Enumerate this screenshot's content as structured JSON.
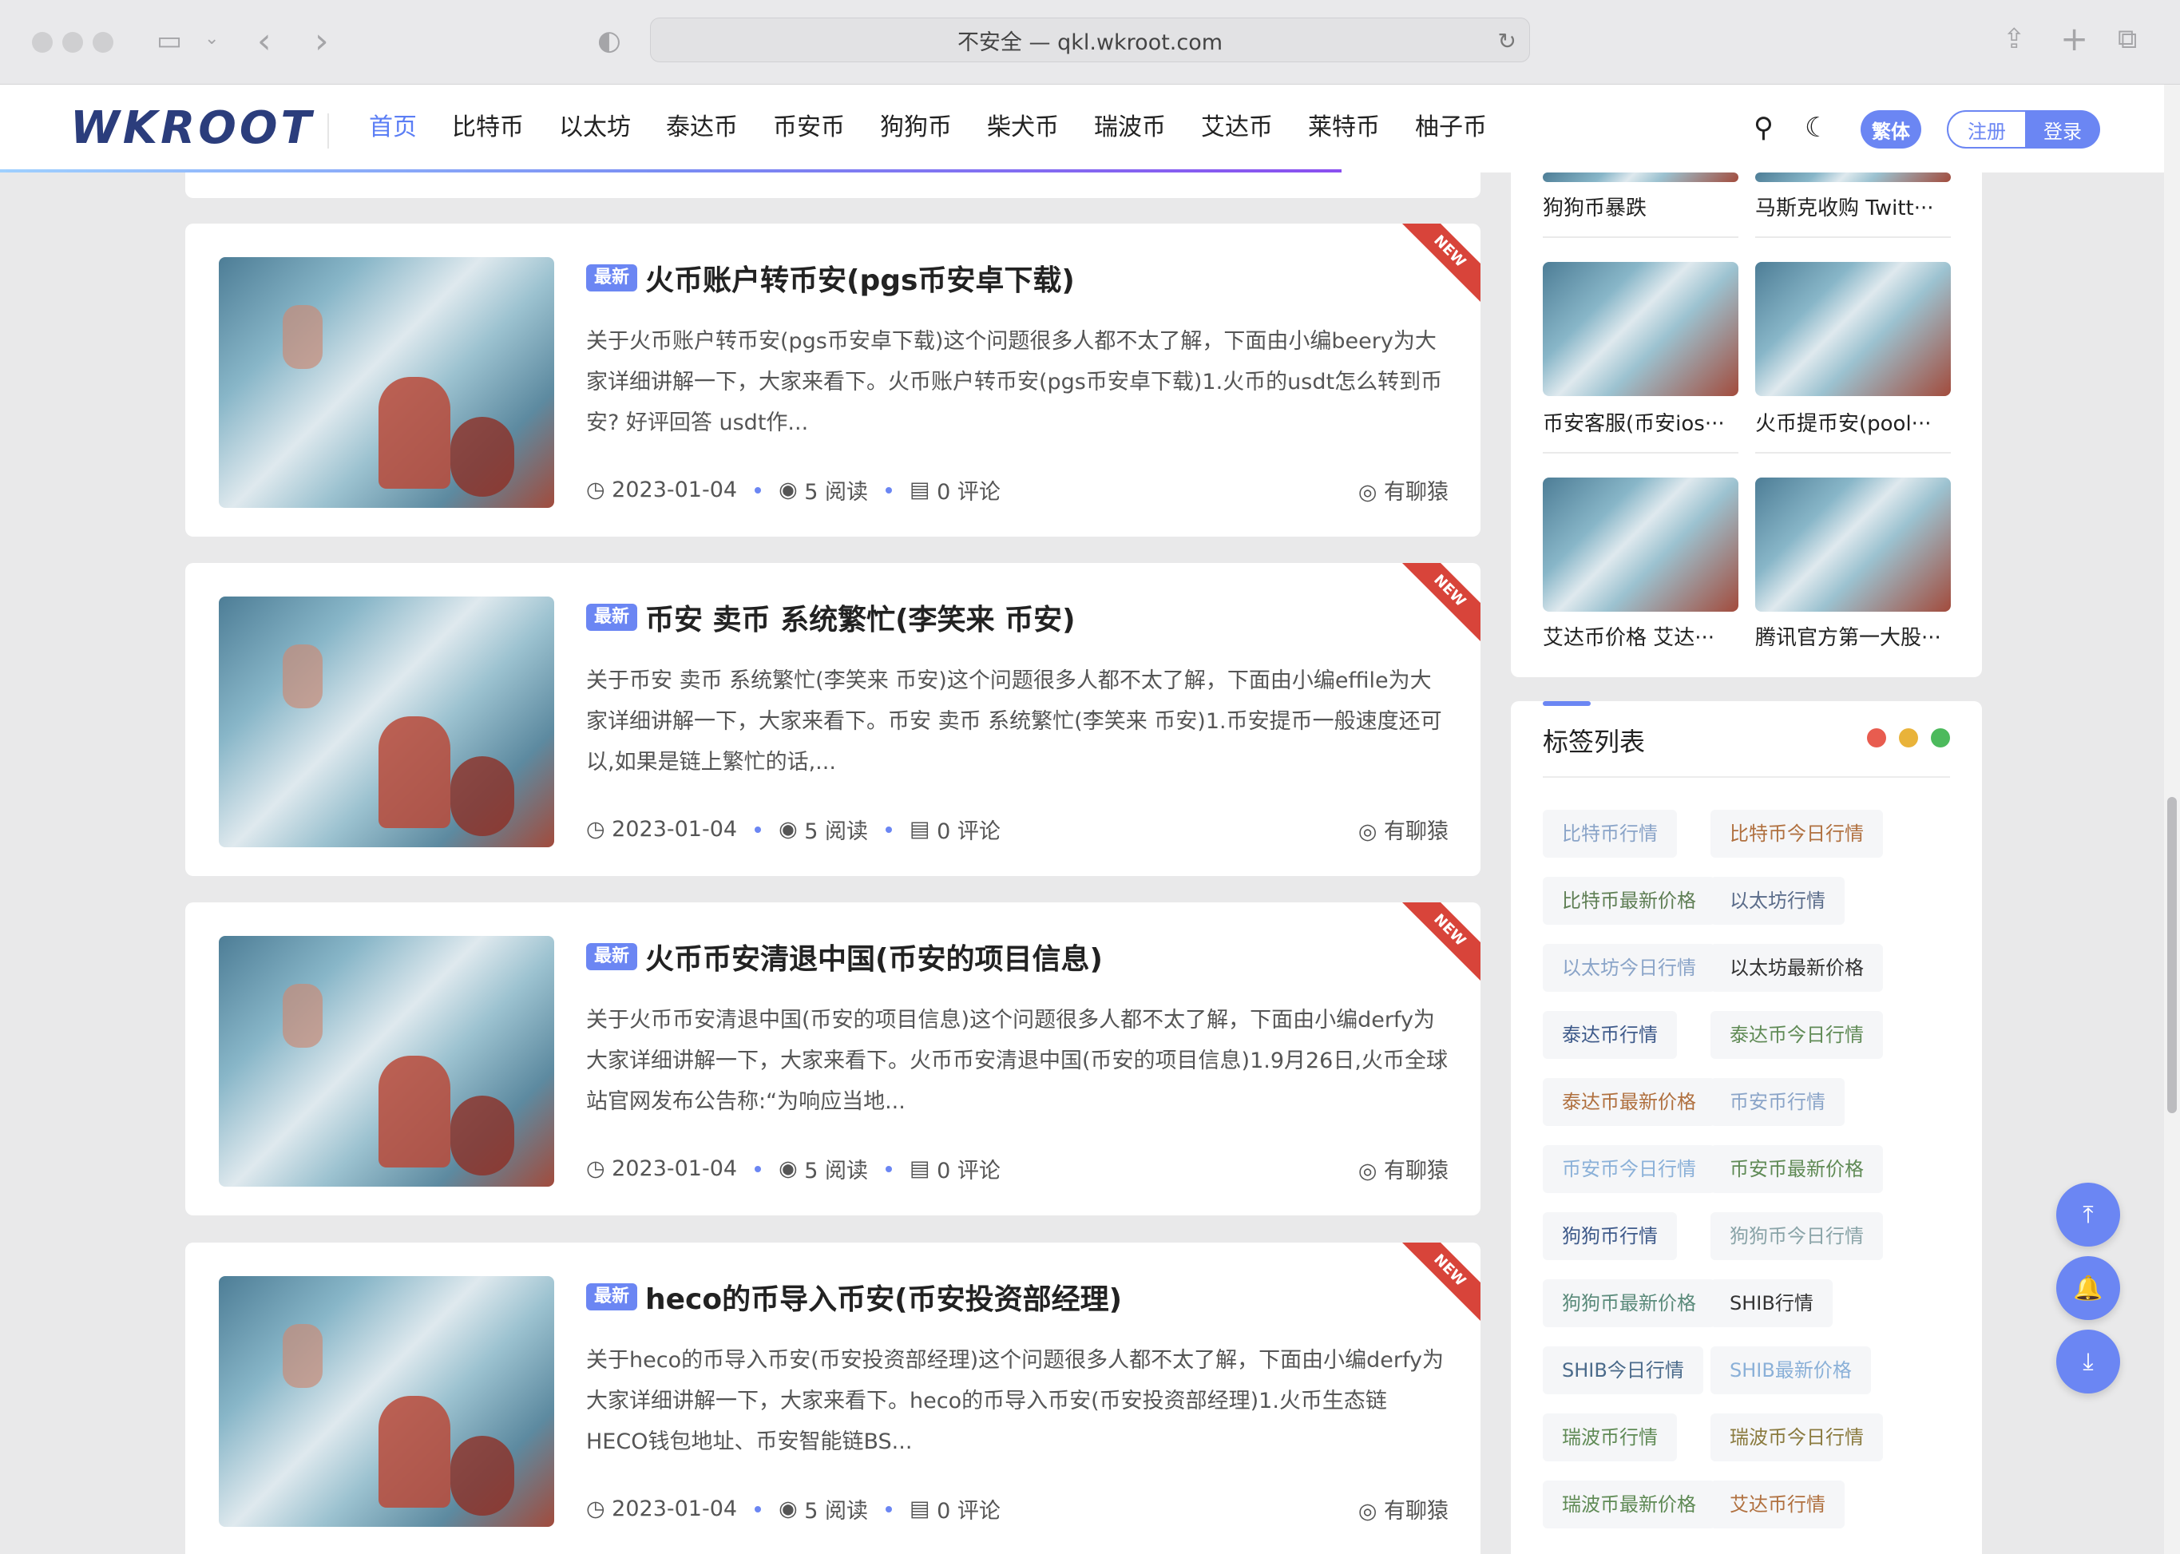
{
  "browser": {
    "url_text": "不安全 — qkl.wkroot.com",
    "back_icon": "‹",
    "forward_icon": "›"
  },
  "site": {
    "logo": "WKROOT",
    "nav": [
      "首页",
      "比特币",
      "以太坊",
      "泰达币",
      "币安币",
      "狗狗币",
      "柴犬币",
      "瑞波币",
      "艾达币",
      "莱特币",
      "柚子币"
    ],
    "traditional_label": "繁体",
    "register_label": "注册",
    "login_label": "登录"
  },
  "articles": [
    {
      "badge": "最新",
      "ribbon": "NEW",
      "title": "火币账户转币安(pgs币安卓下载)",
      "excerpt": "关于火币账户转币安(pgs币安卓下载)这个问题很多人都不太了解，下面由小编beery为大家详细讲解一下，大家来看下。火币账户转币安(pgs币安卓下载)1.火币的usdt怎么转到币安? 好评回答 usdt作...",
      "date": "2023-01-04",
      "views": "5 阅读",
      "comments": "0 评论",
      "author": "有聊猿"
    },
    {
      "badge": "最新",
      "ribbon": "NEW",
      "title": "币安 卖币 系统繁忙(李笑来 币安)",
      "excerpt": "关于币安 卖币 系统繁忙(李笑来 币安)这个问题很多人都不太了解，下面由小编effile为大家详细讲解一下，大家来看下。币安 卖币 系统繁忙(李笑来 币安)1.币安提币一般速度还可以,如果是链上繁忙的话,...",
      "date": "2023-01-04",
      "views": "5 阅读",
      "comments": "0 评论",
      "author": "有聊猿"
    },
    {
      "badge": "最新",
      "ribbon": "NEW",
      "title": "火币币安清退中国(币安的项目信息)",
      "excerpt": "关于火币币安清退中国(币安的项目信息)这个问题很多人都不太了解，下面由小编derfy为大家详细讲解一下，大家来看下。火币币安清退中国(币安的项目信息)1.9月26日,火币全球站官网发布公告称:“为响应当地...",
      "date": "2023-01-04",
      "views": "5 阅读",
      "comments": "0 评论",
      "author": "有聊猿"
    },
    {
      "badge": "最新",
      "ribbon": "NEW",
      "title": "heco的币导入币安(币安投资部经理)",
      "excerpt": "关于heco的币导入币安(币安投资部经理)这个问题很多人都不太了解，下面由小编derfy为大家详细讲解一下，大家来看下。heco的币导入币安(币安投资部经理)1.火币生态链HECO钱包地址、币安智能链BS...",
      "date": "2023-01-04",
      "views": "5 阅读",
      "comments": "0 评论",
      "author": "有聊猿"
    }
  ],
  "sidebar_thumbs": [
    "狗狗币暴跌",
    "马斯克收购 Twitt···",
    "币安客服(币安ios···",
    "火币提币安(pool···",
    "艾达币价格 艾达···",
    "腾讯官方第一大股···"
  ],
  "tags_panel": {
    "title": "标签列表",
    "dot_colors": [
      "#e85c4f",
      "#e9b33a",
      "#4cba5c"
    ],
    "tags": [
      {
        "label": "比特币行情",
        "color": "#8aa4c8"
      },
      {
        "label": "比特币今日行情",
        "color": "#b0703f"
      },
      {
        "label": "比特币最新价格",
        "color": "#5f7f55"
      },
      {
        "label": "以太坊行情",
        "color": "#5a6c8a"
      },
      {
        "label": "以太坊今日行情",
        "color": "#8aa4c8"
      },
      {
        "label": "以太坊最新价格",
        "color": "#333333"
      },
      {
        "label": "泰达币行情",
        "color": "#3e5a8a"
      },
      {
        "label": "泰达币今日行情",
        "color": "#5f8a55"
      },
      {
        "label": "泰达币最新价格",
        "color": "#b0703f"
      },
      {
        "label": "币安币行情",
        "color": "#8aa4c8"
      },
      {
        "label": "币安币今日行情",
        "color": "#8ab0d8"
      },
      {
        "label": "币安币最新价格",
        "color": "#5f8a55"
      },
      {
        "label": "狗狗币行情",
        "color": "#3e5a8a"
      },
      {
        "label": "狗狗币今日行情",
        "color": "#8aa4a8"
      },
      {
        "label": "狗狗币最新价格",
        "color": "#5a8a7a"
      },
      {
        "label": "SHIB行情",
        "color": "#333333"
      },
      {
        "label": "SHIB今日行情",
        "color": "#4a6a8a"
      },
      {
        "label": "SHIB最新价格",
        "color": "#8ab0d8"
      },
      {
        "label": "瑞波币行情",
        "color": "#5f8a55"
      },
      {
        "label": "瑞波币今日行情",
        "color": "#8a7a3e"
      },
      {
        "label": "瑞波币最新价格",
        "color": "#5f8a55"
      },
      {
        "label": "艾达币行情",
        "color": "#b0703f"
      }
    ]
  }
}
